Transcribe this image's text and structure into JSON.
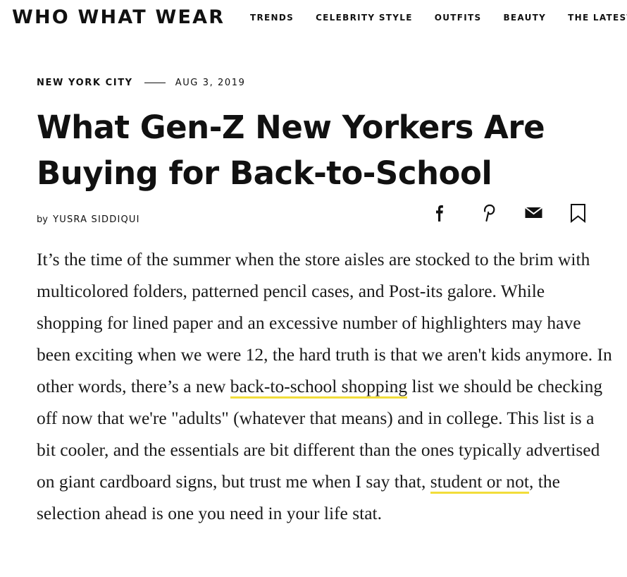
{
  "site": {
    "logo": "WHO WHAT WEAR",
    "nav": [
      "TRENDS",
      "CELEBRITY STYLE",
      "OUTFITS",
      "BEAUTY",
      "THE LATEST"
    ]
  },
  "article": {
    "location": "NEW YORK CITY",
    "date": "AUG 3, 2019",
    "title": "What Gen-Z New Yorkers Are Buying for Back-to-School",
    "byline_prefix": "by",
    "author": "YUSRA SIDDIQUI",
    "share_icons": [
      "facebook-icon",
      "pinterest-icon",
      "email-icon",
      "bookmark-icon"
    ],
    "body": {
      "part1": "It’s the time of the summer when the store aisles are stocked to the brim with multicolored folders, patterned pencil cases, and Post-its galore. While shopping for lined paper and an excessive number of highlighters may have been exciting when we were 12, the hard truth is that we aren't kids anymore. In other words, there’s a new ",
      "link1": "back-to-school shopping",
      "part2": " list we should be checking off now that we're \"adults\" (whatever that means) and in college. This list is a bit cooler, and the essentials are bit different than the ones typically advertised on giant cardboard signs, but trust me when I say that, ",
      "link2": "student or not",
      "part3": ", the selection ahead is one you need in your life stat."
    }
  },
  "colors": {
    "text": "#111111",
    "link_underline": "#f2dd3a",
    "background": "#ffffff"
  }
}
